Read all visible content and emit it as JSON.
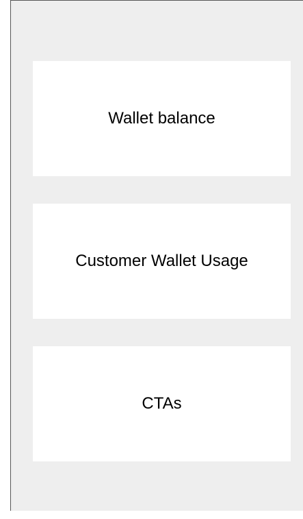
{
  "sections": [
    {
      "label": "Wallet balance"
    },
    {
      "label": "Customer Wallet Usage"
    },
    {
      "label": "CTAs"
    }
  ],
  "colors": {
    "background": "#eeeeee",
    "card": "#ffffff",
    "border": "#555555",
    "text": "#000000"
  }
}
